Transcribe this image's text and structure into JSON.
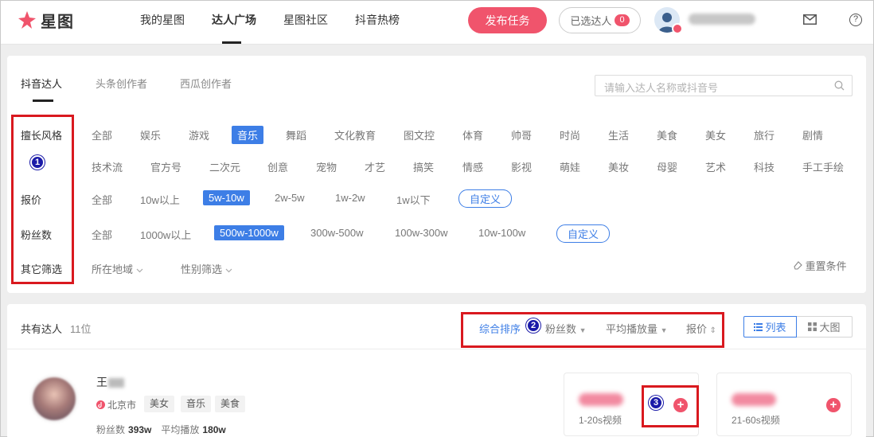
{
  "header": {
    "logo_text": "星图",
    "nav": [
      "我的星图",
      "达人广场",
      "星图社区",
      "抖音热榜"
    ],
    "publish_label": "发布任务",
    "selected_label": "已选达人",
    "selected_count": "0"
  },
  "tabs": [
    "抖音达人",
    "头条创作者",
    "西瓜创作者"
  ],
  "search": {
    "placeholder": "请输入达人名称或抖音号"
  },
  "filters": {
    "specialty_label": "擅长风格",
    "specialty_row1": [
      "全部",
      "娱乐",
      "游戏",
      "音乐",
      "舞蹈",
      "文化教育",
      "图文控",
      "体育",
      "帅哥",
      "时尚",
      "生活",
      "美食",
      "美女",
      "旅行",
      "剧情"
    ],
    "specialty_row2": [
      "技术流",
      "官方号",
      "二次元",
      "创意",
      "宠物",
      "才艺",
      "搞笑",
      "情感",
      "影视",
      "萌娃",
      "美妆",
      "母婴",
      "艺术",
      "科技",
      "手工手绘"
    ],
    "specialty_selected": "音乐",
    "price_label": "报价",
    "price_options": [
      "全部",
      "10w以上",
      "5w-10w",
      "2w-5w",
      "1w-2w",
      "1w以下"
    ],
    "price_selected": "5w-10w",
    "price_custom": "自定义",
    "fans_label": "粉丝数",
    "fans_options": [
      "全部",
      "1000w以上",
      "500w-1000w",
      "300w-500w",
      "100w-300w",
      "10w-100w"
    ],
    "fans_selected": "500w-1000w",
    "fans_custom": "自定义",
    "other_label": "其它筛选",
    "region_label": "所在地域",
    "gender_label": "性别筛选",
    "reset_label": "重置条件"
  },
  "results": {
    "count_label": "共有达人",
    "count_value": "11位",
    "sort_options": [
      "综合排序",
      "粉丝数",
      "平均播放量",
      "报价"
    ],
    "sort_active": "综合排序",
    "view_list": "列表",
    "view_grid": "大图"
  },
  "kol": {
    "name_visible": "王",
    "location": "北京市",
    "tags": [
      "美女",
      "音乐",
      "美食"
    ],
    "fans_label": "粉丝数",
    "fans_value": "393w",
    "play_label": "平均播放",
    "play_value": "180w",
    "price_cards": [
      {
        "label": "1-20s视频"
      },
      {
        "label": "21-60s视频"
      }
    ]
  },
  "annotations": [
    "1",
    "2",
    "3"
  ],
  "colors": {
    "accent": "#3d7ee6",
    "brand": "#f0546c",
    "annotation_red": "#d9191f",
    "annotation_marker": "#1a1aa8"
  }
}
